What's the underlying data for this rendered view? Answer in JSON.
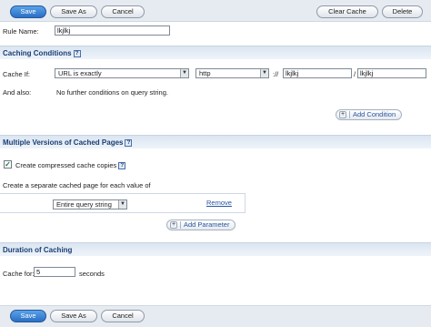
{
  "toolbar": {
    "save_label": "Save",
    "save_as_label": "Save As",
    "cancel_label": "Cancel",
    "clear_cache_label": "Clear Cache",
    "delete_label": "Delete"
  },
  "rule": {
    "name_label": "Rule Name:",
    "name_value": "lkjlkj"
  },
  "caching_conditions": {
    "title": "Caching Conditions",
    "cache_if_label": "Cache If:",
    "condition_select": "URL is exactly",
    "protocol_select": "http",
    "scheme_sep": "://",
    "host_value": "lkjlkj",
    "path_sep": "/",
    "path_value": "lkjlkj",
    "and_also_label": "And also:",
    "and_also_text": "No further conditions on query string.",
    "add_condition_label": "Add Condition"
  },
  "versions": {
    "title": "Multiple Versions of Cached Pages",
    "compress_label": "Create compressed cache copies",
    "compress_checked": true,
    "separate_label": "Create a separate cached page for each value of",
    "query_select": "Entire query string",
    "remove_label": "Remove",
    "add_parameter_label": "Add Parameter"
  },
  "duration": {
    "title": "Duration of Caching",
    "cache_for_label": "Cache for:",
    "seconds_value": "5",
    "seconds_label": "seconds"
  }
}
